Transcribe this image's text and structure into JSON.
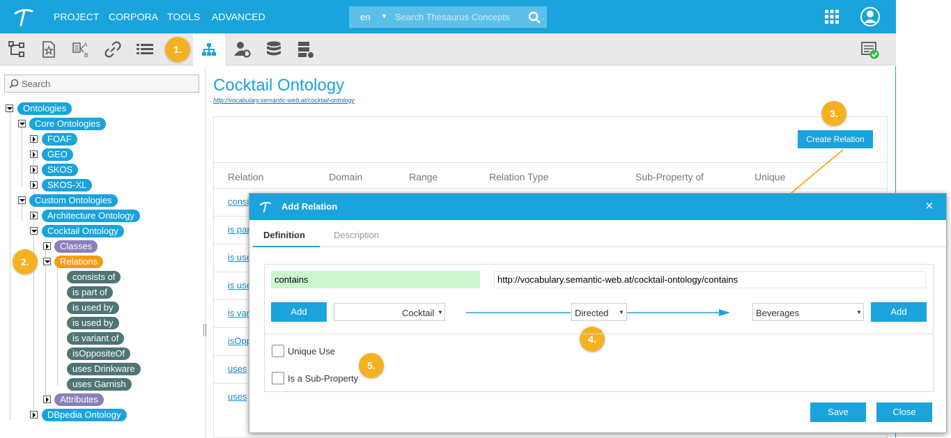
{
  "topbar": {
    "menu": [
      "PROJECT",
      "CORPORA",
      "TOOLS",
      "ADVANCED"
    ],
    "search": {
      "lang": "en",
      "placeholder": "Search Thesaurus Concepts"
    }
  },
  "toolbar": {
    "icons": [
      "hierarchy-icon",
      "favorites-icon",
      "compare-icon",
      "link-icon",
      "list-icon",
      "ontology-tree-icon",
      "user-settings-icon",
      "database-icon",
      "server-icon",
      "status-ok-icon"
    ]
  },
  "badges": {
    "b1": "1.",
    "b2": "2.",
    "b3": "3.",
    "b4": "4.",
    "b5": "5."
  },
  "tree": {
    "search_placeholder": "Search",
    "nodes": {
      "ontologies": "Ontologies",
      "core": "Core Ontologies",
      "foaf": "FOAF",
      "geo": "GEO",
      "skos": "SKOS",
      "skosxl": "SKOS-XL",
      "custom": "Custom Ontologies",
      "architecture": "Architecture Ontology",
      "cocktail": "Cocktail Ontology",
      "classes": "Classes",
      "relations": "Relations",
      "attributes": "Attributes",
      "dbpedia": "DBpedia Ontology"
    },
    "relations": [
      "consists of",
      "is part of",
      "is used by",
      "is used by",
      "is variant of",
      "isOppositeOf",
      "uses Drinkware",
      "uses Garnish"
    ]
  },
  "main": {
    "title": "Cocktail Ontology",
    "url": "http://vocabulary.semantic-web.at/cocktail-ontology",
    "create_button": "Create Relation",
    "columns": [
      "Relation",
      "Domain",
      "Range",
      "Relation Type",
      "Sub-Property of",
      "Unique"
    ],
    "rows": [
      "consi",
      "is par",
      "is use",
      "is use",
      "is var",
      "isOpp",
      "uses",
      "uses"
    ]
  },
  "dialog": {
    "title": "Add Relation",
    "close": "×",
    "tabs": {
      "definition": "Definition",
      "description": "Description"
    },
    "name_value": "contains",
    "uri_value": "http://vocabulary.semantic-web.at/cocktail-ontology/contains",
    "add_left": "Add",
    "domain_select": "Cocktail",
    "type_select": "Directed",
    "range_select": "Beverages",
    "add_right": "Add",
    "unique_use": "Unique Use",
    "sub_property": "Is a Sub-Property",
    "save": "Save",
    "close_btn": "Close"
  },
  "colors": {
    "primary": "#1aa3dc",
    "badge": "#f4b223",
    "relations": "#f39c12",
    "classes": "#8b7fb8",
    "leaf": "#4f7474"
  }
}
